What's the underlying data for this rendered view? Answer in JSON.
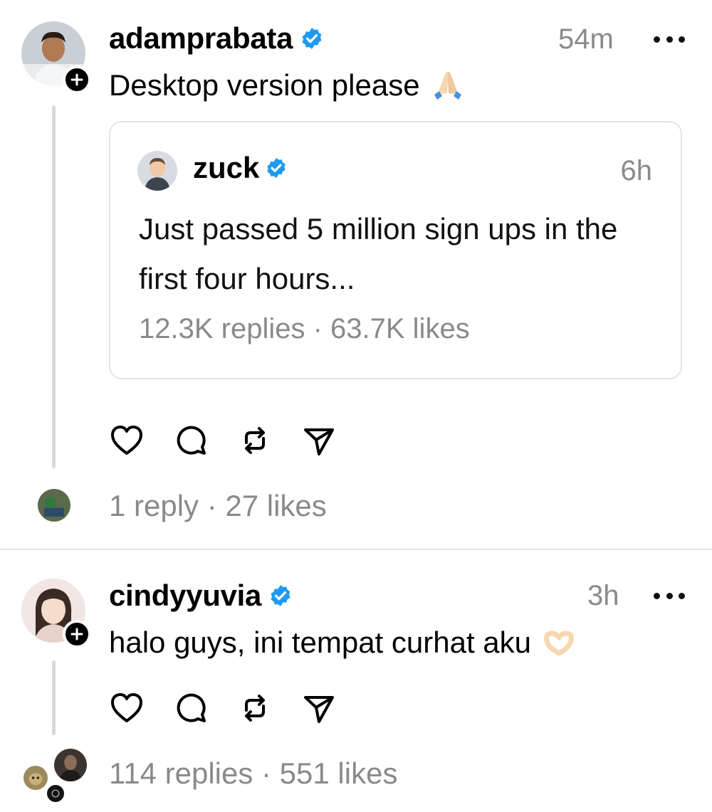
{
  "posts": [
    {
      "username": "adamprabata",
      "time": "54m",
      "text": "Desktop version please",
      "emoji": "folded-hands",
      "quote": {
        "username": "zuck",
        "time": "6h",
        "text": "Just passed 5 million sign ups in the first four hours...",
        "stats": "12.3K replies · 63.7K likes"
      },
      "stats": "1 reply · 27 likes"
    },
    {
      "username": "cindyyuvia",
      "time": "3h",
      "text": "halo guys, ini tempat curhat aku",
      "emoji": "heart-hands",
      "stats": "114 replies · 551 likes"
    }
  ],
  "icons": {
    "like": "heart-icon",
    "reply": "comment-icon",
    "repost": "repost-icon",
    "share": "send-icon",
    "more": "more-dots-icon",
    "verified": "verified-badge-icon",
    "follow": "plus-icon"
  },
  "colors": {
    "verified": "#1d9bf0",
    "muted": "#8a8a8a",
    "divider": "#e6e6e6",
    "thread_line": "#d8d8d8"
  }
}
